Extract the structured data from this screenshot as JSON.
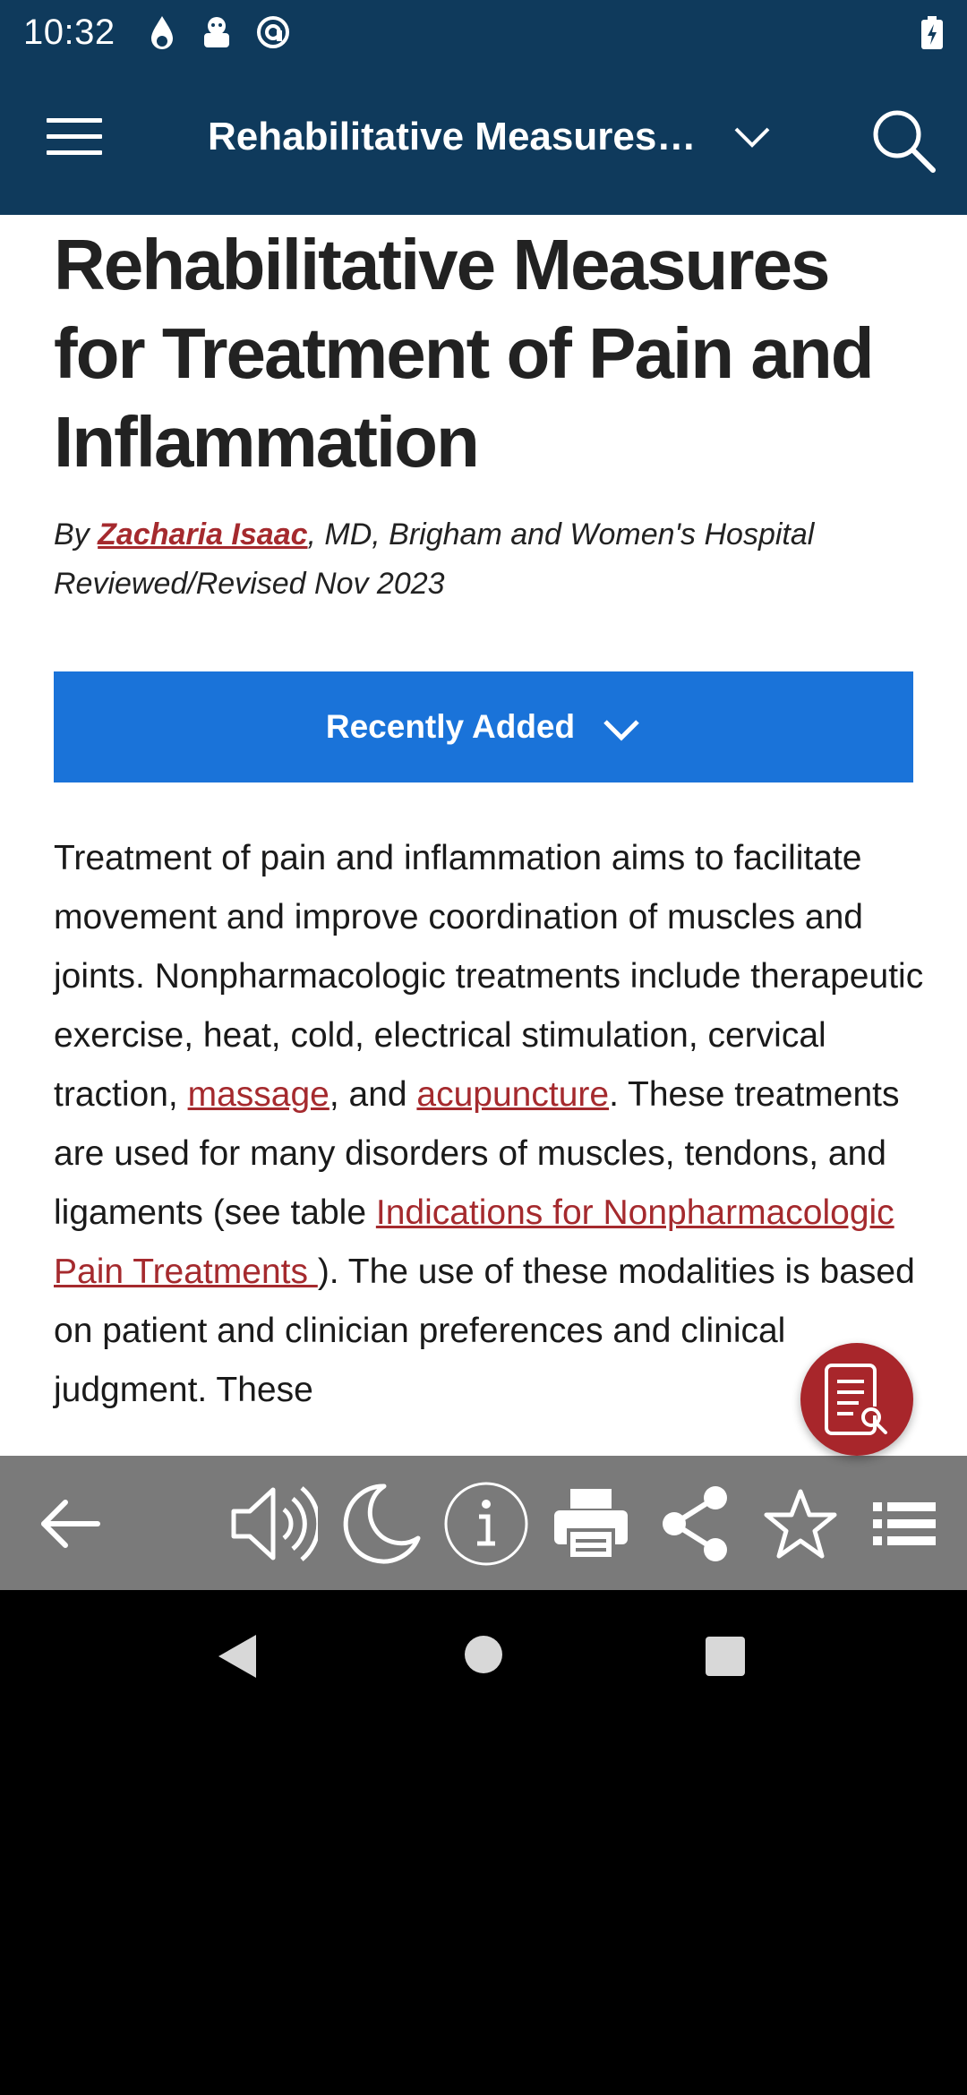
{
  "status_bar": {
    "time": "10:32"
  },
  "app_bar": {
    "title": "Rehabilitative Measures…"
  },
  "article": {
    "title": "Rehabilitative Measures for Treatment of Pain and Inflammation",
    "byline_prefix": "By ",
    "author": "Zacharia Isaac",
    "byline_suffix": ", MD, Brigham and Women's Hospital",
    "reviewed": "Reviewed/Revised Nov 2023",
    "recently_added_label": "Recently Added",
    "body": {
      "part1": "Treatment of pain and inflammation aims to facilitate movement and improve coordination of muscles and joints. Nonpharmacologic treatments include therapeutic exercise, heat, cold, electrical stimulation, cervical traction, ",
      "link_massage": "massage",
      "part2": ", and ",
      "link_acupuncture": "acupuncture",
      "part3": ". These treatments are used for many disorders of muscles, tendons, and ligaments (see table ",
      "link_table": "Indications for Nonpharmacologic Pain Treatments ",
      "part4": "). The use of these modalities is based on patient and clinician preferences and clinical judgment. These"
    }
  },
  "toolbar": {
    "items": [
      "back",
      "audio",
      "night-mode",
      "info",
      "print",
      "share",
      "favorite",
      "contents"
    ]
  },
  "colors": {
    "header": "#0f3a5c",
    "accent_blue": "#1a73d9",
    "link_red": "#a52a2e",
    "toolbar": "#7a7a7a"
  }
}
